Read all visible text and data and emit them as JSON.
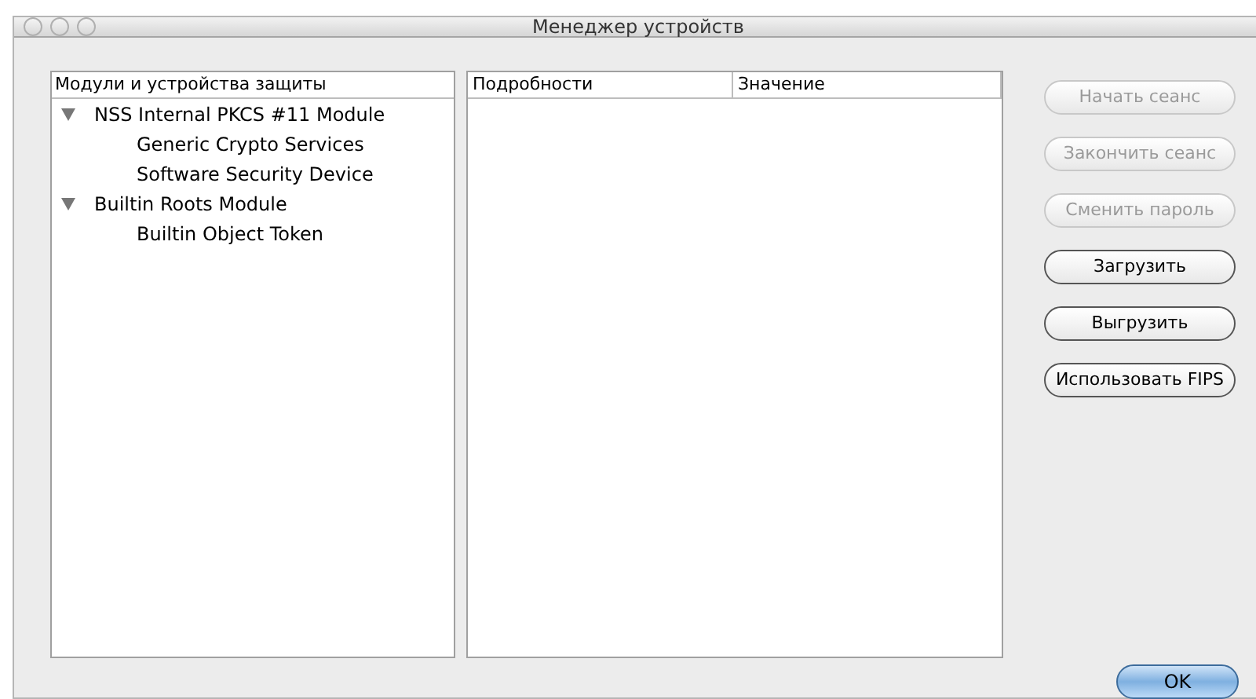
{
  "window": {
    "title": "Менеджер устройств"
  },
  "modules": {
    "header": "Модули и устройства защиты",
    "items": [
      {
        "label": "NSS Internal PKCS #11 Module",
        "expanded": true,
        "children": [
          {
            "label": "Generic Crypto Services"
          },
          {
            "label": "Software Security Device"
          }
        ]
      },
      {
        "label": "Builtin Roots Module",
        "expanded": true,
        "children": [
          {
            "label": "Builtin Object Token"
          }
        ]
      }
    ]
  },
  "details": {
    "columns": [
      "Подробности",
      "Значение"
    ]
  },
  "buttons": [
    {
      "label": "Начать сеанс",
      "disabled": true
    },
    {
      "label": "Закончить сеанс",
      "disabled": true
    },
    {
      "label": "Сменить пароль",
      "disabled": true
    },
    {
      "label": "Загрузить",
      "disabled": false
    },
    {
      "label": "Выгрузить",
      "disabled": false
    },
    {
      "label": "Использовать FIPS",
      "disabled": false
    }
  ],
  "ok_button": {
    "label": "OK"
  }
}
